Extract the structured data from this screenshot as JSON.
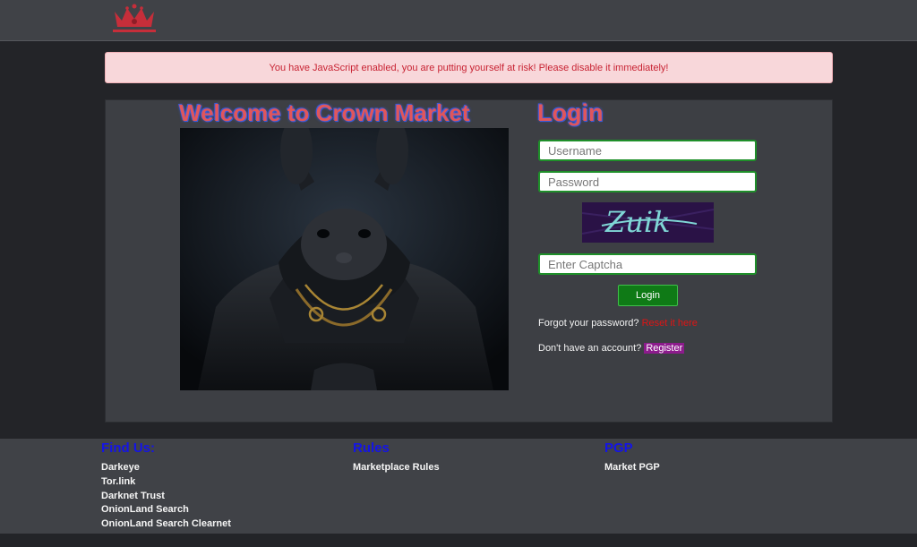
{
  "alert": {
    "text": "You have JavaScript enabled, you are putting yourself at risk! Please disable it immediately!"
  },
  "welcome": {
    "title": "Welcome to Crown Market"
  },
  "login": {
    "title": "Login",
    "username_placeholder": "Username",
    "password_placeholder": "Password",
    "captcha_text": "Zuik",
    "captcha_placeholder": "Enter Captcha",
    "button_label": "Login",
    "forgot_text": "Forgot your password?",
    "reset_link": "Reset it here",
    "no_account_text": "Don't have an account?",
    "register_link": "Register"
  },
  "footer": {
    "find_us": {
      "heading": "Find Us:",
      "items": [
        "Darkeye",
        "Tor.link",
        "Darknet Trust",
        "OnionLand Search",
        "OnionLand Search Clearnet"
      ]
    },
    "rules": {
      "heading": "Rules",
      "items": [
        "Marketplace Rules"
      ]
    },
    "pgp": {
      "heading": "PGP",
      "items": [
        "Market PGP"
      ]
    }
  },
  "colors": {
    "title_red": "#e0565b",
    "title_outline_blue": "#3b5bdb",
    "input_border_green": "#1f8f2a",
    "login_button_green": "#0f7a16",
    "footer_heading_blue": "#1414e6",
    "alert_bg": "#f8d7da",
    "alert_text": "#c82333"
  },
  "icons": {
    "logo": "crown-logo-icon"
  }
}
